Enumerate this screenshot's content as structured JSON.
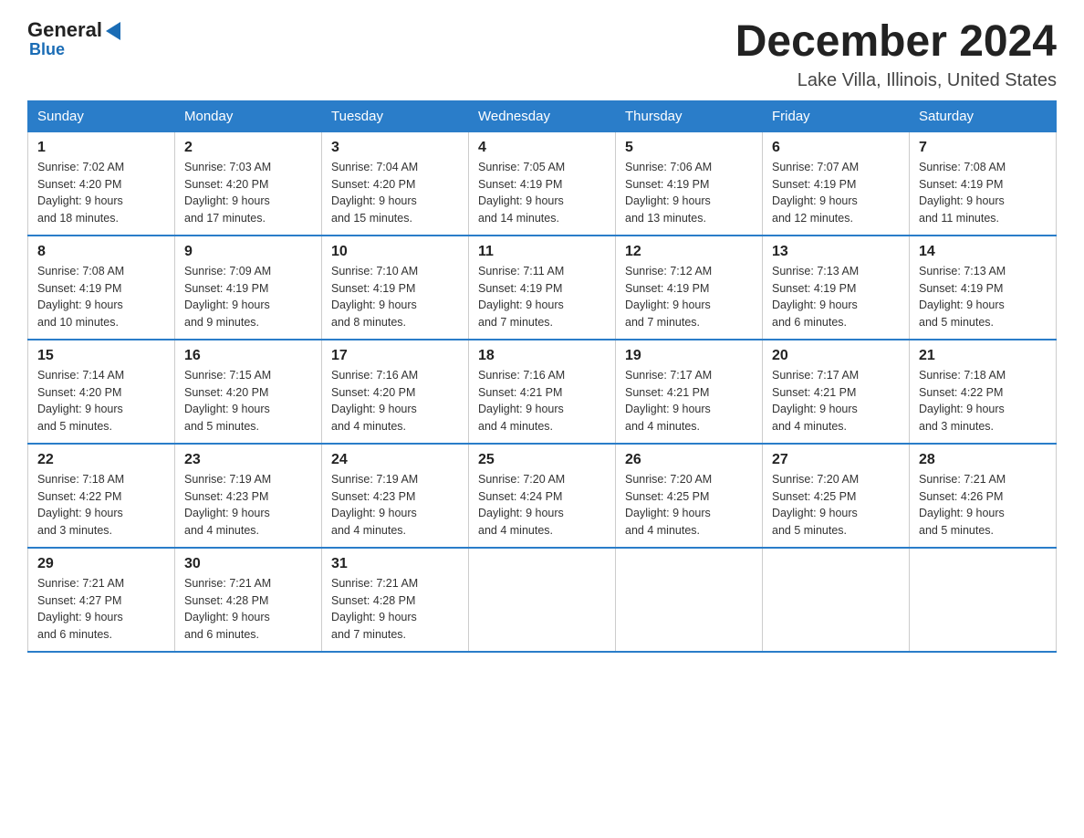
{
  "logo": {
    "general": "General",
    "blue": "Blue",
    "subtitle": "Blue"
  },
  "title": "December 2024",
  "location": "Lake Villa, Illinois, United States",
  "days_of_week": [
    "Sunday",
    "Monday",
    "Tuesday",
    "Wednesday",
    "Thursday",
    "Friday",
    "Saturday"
  ],
  "weeks": [
    [
      {
        "day": "1",
        "sunrise": "7:02 AM",
        "sunset": "4:20 PM",
        "daylight": "9 hours and 18 minutes."
      },
      {
        "day": "2",
        "sunrise": "7:03 AM",
        "sunset": "4:20 PM",
        "daylight": "9 hours and 17 minutes."
      },
      {
        "day": "3",
        "sunrise": "7:04 AM",
        "sunset": "4:20 PM",
        "daylight": "9 hours and 15 minutes."
      },
      {
        "day": "4",
        "sunrise": "7:05 AM",
        "sunset": "4:19 PM",
        "daylight": "9 hours and 14 minutes."
      },
      {
        "day": "5",
        "sunrise": "7:06 AM",
        "sunset": "4:19 PM",
        "daylight": "9 hours and 13 minutes."
      },
      {
        "day": "6",
        "sunrise": "7:07 AM",
        "sunset": "4:19 PM",
        "daylight": "9 hours and 12 minutes."
      },
      {
        "day": "7",
        "sunrise": "7:08 AM",
        "sunset": "4:19 PM",
        "daylight": "9 hours and 11 minutes."
      }
    ],
    [
      {
        "day": "8",
        "sunrise": "7:08 AM",
        "sunset": "4:19 PM",
        "daylight": "9 hours and 10 minutes."
      },
      {
        "day": "9",
        "sunrise": "7:09 AM",
        "sunset": "4:19 PM",
        "daylight": "9 hours and 9 minutes."
      },
      {
        "day": "10",
        "sunrise": "7:10 AM",
        "sunset": "4:19 PM",
        "daylight": "9 hours and 8 minutes."
      },
      {
        "day": "11",
        "sunrise": "7:11 AM",
        "sunset": "4:19 PM",
        "daylight": "9 hours and 7 minutes."
      },
      {
        "day": "12",
        "sunrise": "7:12 AM",
        "sunset": "4:19 PM",
        "daylight": "9 hours and 7 minutes."
      },
      {
        "day": "13",
        "sunrise": "7:13 AM",
        "sunset": "4:19 PM",
        "daylight": "9 hours and 6 minutes."
      },
      {
        "day": "14",
        "sunrise": "7:13 AM",
        "sunset": "4:19 PM",
        "daylight": "9 hours and 5 minutes."
      }
    ],
    [
      {
        "day": "15",
        "sunrise": "7:14 AM",
        "sunset": "4:20 PM",
        "daylight": "9 hours and 5 minutes."
      },
      {
        "day": "16",
        "sunrise": "7:15 AM",
        "sunset": "4:20 PM",
        "daylight": "9 hours and 5 minutes."
      },
      {
        "day": "17",
        "sunrise": "7:16 AM",
        "sunset": "4:20 PM",
        "daylight": "9 hours and 4 minutes."
      },
      {
        "day": "18",
        "sunrise": "7:16 AM",
        "sunset": "4:21 PM",
        "daylight": "9 hours and 4 minutes."
      },
      {
        "day": "19",
        "sunrise": "7:17 AM",
        "sunset": "4:21 PM",
        "daylight": "9 hours and 4 minutes."
      },
      {
        "day": "20",
        "sunrise": "7:17 AM",
        "sunset": "4:21 PM",
        "daylight": "9 hours and 4 minutes."
      },
      {
        "day": "21",
        "sunrise": "7:18 AM",
        "sunset": "4:22 PM",
        "daylight": "9 hours and 3 minutes."
      }
    ],
    [
      {
        "day": "22",
        "sunrise": "7:18 AM",
        "sunset": "4:22 PM",
        "daylight": "9 hours and 3 minutes."
      },
      {
        "day": "23",
        "sunrise": "7:19 AM",
        "sunset": "4:23 PM",
        "daylight": "9 hours and 4 minutes."
      },
      {
        "day": "24",
        "sunrise": "7:19 AM",
        "sunset": "4:23 PM",
        "daylight": "9 hours and 4 minutes."
      },
      {
        "day": "25",
        "sunrise": "7:20 AM",
        "sunset": "4:24 PM",
        "daylight": "9 hours and 4 minutes."
      },
      {
        "day": "26",
        "sunrise": "7:20 AM",
        "sunset": "4:25 PM",
        "daylight": "9 hours and 4 minutes."
      },
      {
        "day": "27",
        "sunrise": "7:20 AM",
        "sunset": "4:25 PM",
        "daylight": "9 hours and 5 minutes."
      },
      {
        "day": "28",
        "sunrise": "7:21 AM",
        "sunset": "4:26 PM",
        "daylight": "9 hours and 5 minutes."
      }
    ],
    [
      {
        "day": "29",
        "sunrise": "7:21 AM",
        "sunset": "4:27 PM",
        "daylight": "9 hours and 6 minutes."
      },
      {
        "day": "30",
        "sunrise": "7:21 AM",
        "sunset": "4:28 PM",
        "daylight": "9 hours and 6 minutes."
      },
      {
        "day": "31",
        "sunrise": "7:21 AM",
        "sunset": "4:28 PM",
        "daylight": "9 hours and 7 minutes."
      },
      null,
      null,
      null,
      null
    ]
  ],
  "labels": {
    "sunrise": "Sunrise:",
    "sunset": "Sunset:",
    "daylight": "Daylight:"
  }
}
